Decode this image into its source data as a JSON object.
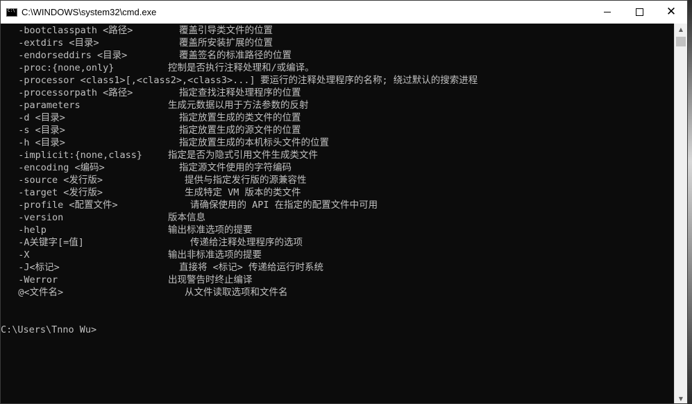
{
  "window": {
    "title": "C:\\WINDOWS\\system32\\cmd.exe"
  },
  "console": {
    "entries": [
      {
        "opt": "  -bootclasspath <路径>",
        "desc": "覆盖引导类文件的位置"
      },
      {
        "opt": "  -extdirs <目录>",
        "desc": "覆盖所安装扩展的位置"
      },
      {
        "opt": "  -endorseddirs <目录>",
        "desc": "覆盖签名的标准路径的位置"
      },
      {
        "opt": "  -proc:{none,only}",
        "desc": "控制是否执行注释处理和/或编译。"
      },
      {
        "opt": "  -processor <class1>[,<class2>,<class3>...]",
        "desc": "要运行的注释处理程序的名称; 绕过默认的搜索进程"
      },
      {
        "opt": "  -processorpath <路径>",
        "desc": "指定查找注释处理程序的位置"
      },
      {
        "opt": "  -parameters",
        "desc": "生成元数据以用于方法参数的反射"
      },
      {
        "opt": "  -d <目录>",
        "desc": "指定放置生成的类文件的位置"
      },
      {
        "opt": "  -s <目录>",
        "desc": "指定放置生成的源文件的位置"
      },
      {
        "opt": "  -h <目录>",
        "desc": "指定放置生成的本机标头文件的位置"
      },
      {
        "opt": "  -implicit:{none,class}",
        "desc": "指定是否为隐式引用文件生成类文件"
      },
      {
        "opt": "  -encoding <编码>",
        "desc": "指定源文件使用的字符编码"
      },
      {
        "opt": "  -source <发行版>",
        "desc": "提供与指定发行版的源兼容性"
      },
      {
        "opt": "  -target <发行版>",
        "desc": "生成特定 VM 版本的类文件"
      },
      {
        "opt": "  -profile <配置文件>",
        "desc": "请确保使用的 API 在指定的配置文件中可用"
      },
      {
        "opt": "  -version",
        "desc": "版本信息"
      },
      {
        "opt": "  -help",
        "desc": "输出标准选项的提要"
      },
      {
        "opt": "  -A关键字[=值]",
        "desc": "传递给注释处理程序的选项"
      },
      {
        "opt": "  -X",
        "desc": "输出非标准选项的提要"
      },
      {
        "opt": "  -J<标记>",
        "desc": "直接将 <标记> 传递给运行时系统"
      },
      {
        "opt": "  -Werror",
        "desc": "出现警告时终止编译"
      },
      {
        "opt": "  @<文件名>",
        "desc": "从文件读取选项和文件名"
      }
    ],
    "prompt": "C:\\Users\\Tnno Wu>"
  }
}
